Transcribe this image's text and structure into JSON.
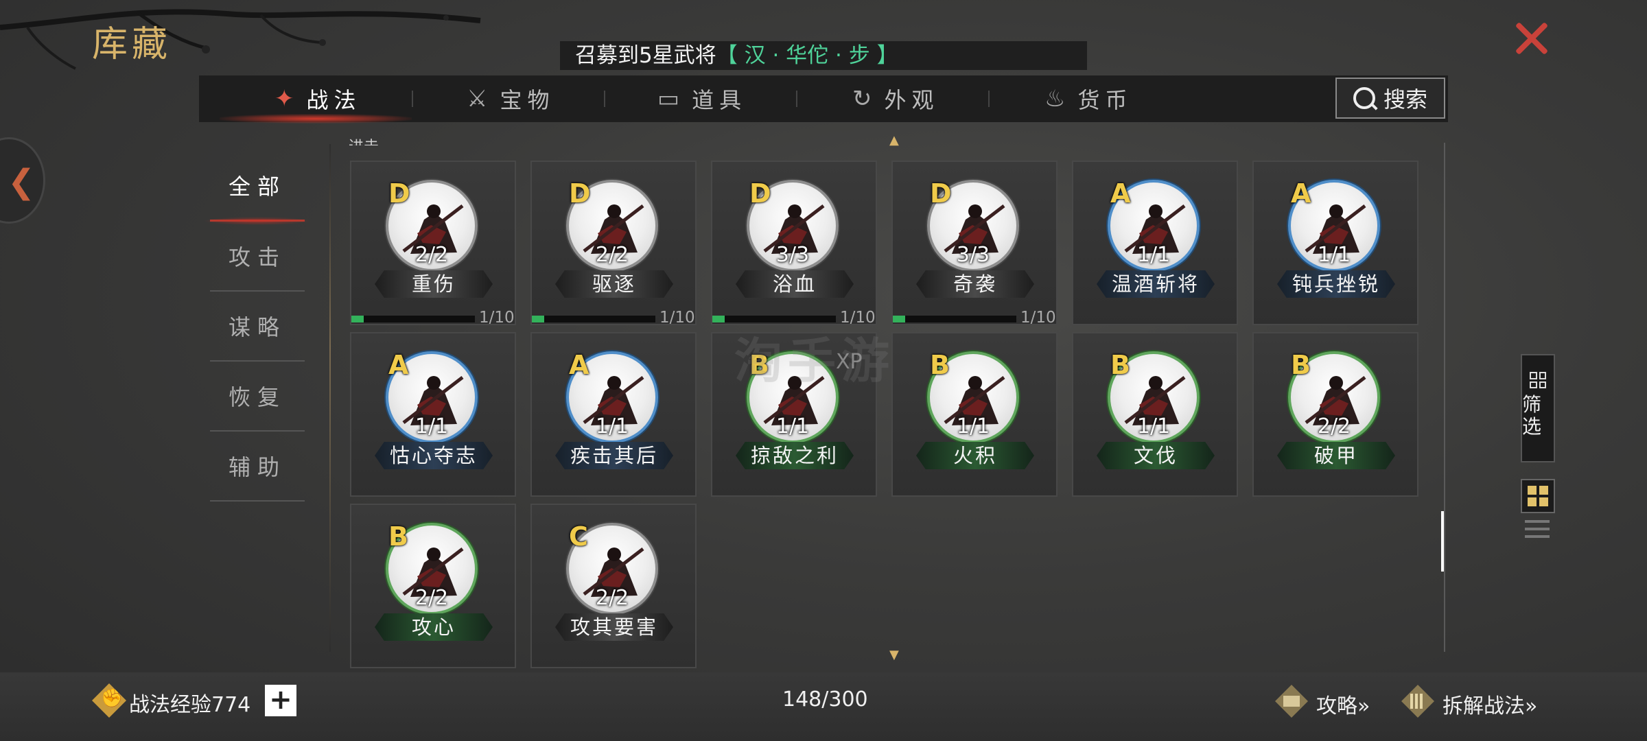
{
  "header": {
    "title": "库藏"
  },
  "notice": {
    "prefix": "召募到5星武将",
    "highlight": "【 汉 · 华佗 · 步 】"
  },
  "tabs": [
    {
      "label": "战法",
      "icon": "scroll-icon",
      "active": true
    },
    {
      "label": "宝物",
      "icon": "weapon-icon",
      "active": false
    },
    {
      "label": "道具",
      "icon": "chest-icon",
      "active": false
    },
    {
      "label": "外观",
      "icon": "swirl-icon",
      "active": false
    },
    {
      "label": "货币",
      "icon": "money-bag-icon",
      "active": false
    }
  ],
  "search": {
    "label": "搜索"
  },
  "categories": [
    {
      "label": "全部",
      "active": true
    },
    {
      "label": "攻击",
      "active": false
    },
    {
      "label": "谋略",
      "active": false
    },
    {
      "label": "恢复",
      "active": false
    },
    {
      "label": "辅助",
      "active": false
    }
  ],
  "cutoff_label": "进击",
  "cards": [
    {
      "grade": "D",
      "count": "2/2",
      "name": "重伤",
      "progress": "1/10",
      "progress_fraction": 0.1
    },
    {
      "grade": "D",
      "count": "2/2",
      "name": "驱逐",
      "progress": "1/10",
      "progress_fraction": 0.1
    },
    {
      "grade": "D",
      "count": "3/3",
      "name": "浴血",
      "progress": "1/10",
      "progress_fraction": 0.1
    },
    {
      "grade": "D",
      "count": "3/3",
      "name": "奇袭",
      "progress": "1/10",
      "progress_fraction": 0.1
    },
    {
      "grade": "A",
      "count": "1/1",
      "name": "温酒斩将"
    },
    {
      "grade": "A",
      "count": "1/1",
      "name": "钝兵挫锐"
    },
    {
      "grade": "A",
      "count": "1/1",
      "name": "怙心夺志"
    },
    {
      "grade": "A",
      "count": "1/1",
      "name": "疾击其后"
    },
    {
      "grade": "B",
      "count": "1/1",
      "name": "掠敌之利"
    },
    {
      "grade": "B",
      "count": "1/1",
      "name": "火积"
    },
    {
      "grade": "B",
      "count": "1/1",
      "name": "文伐"
    },
    {
      "grade": "B",
      "count": "2/2",
      "name": "破甲"
    },
    {
      "grade": "B",
      "count": "2/2",
      "name": "攻心"
    },
    {
      "grade": "C",
      "count": "2/2",
      "name": "攻其要害"
    }
  ],
  "side": {
    "filter_label": "筛选"
  },
  "footer": {
    "exp_label": "战法经验774",
    "plus_label": "+",
    "capacity": "148/300",
    "guide_label": "攻略»",
    "disassemble_label": "拆解战法»"
  },
  "watermark": {
    "text": "淘手游",
    "xp": "XP"
  },
  "colors": {
    "accent_red": "#c9423a",
    "title_gold": "#d8b46a",
    "grade_gold": "#f0cb4a",
    "grade_A": "#4f8ec9",
    "grade_B": "#5fa65c",
    "grade_CD": "#8d8d8d",
    "notice_green": "#4fd39a"
  }
}
